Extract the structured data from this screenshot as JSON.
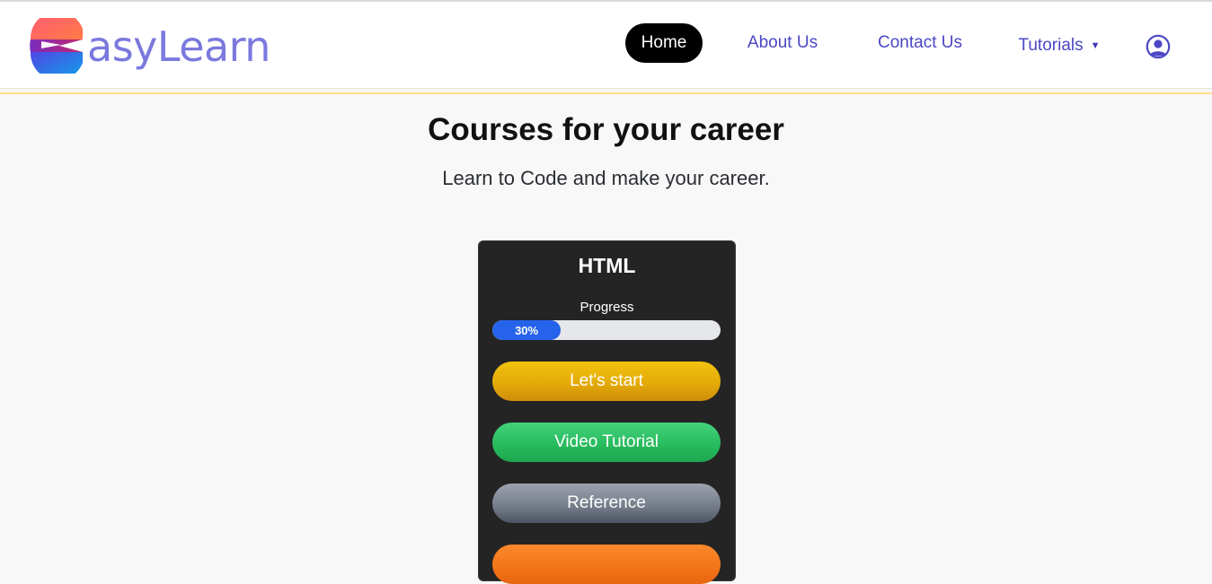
{
  "brand": {
    "text": "asyLearn",
    "text_color": "#7b79dd",
    "logo_icon": "easylearn-logo-e-icon"
  },
  "nav": {
    "items": [
      {
        "label": "Home",
        "active": true
      },
      {
        "label": "About Us",
        "active": false
      },
      {
        "label": "Contact Us",
        "active": false
      },
      {
        "label": "Tutorials",
        "active": false,
        "dropdown": true
      }
    ],
    "dropdown_icon": "caret-down-icon",
    "caret": "▼",
    "account_icon": "user-circle-icon",
    "link_color": "#4b47c4"
  },
  "hero": {
    "title": "Courses for your career",
    "subtitle": "Learn to Code and make your career."
  },
  "course_card": {
    "title": "HTML",
    "progress_label": "Progress",
    "progress_percent": 30,
    "progress_text": "30%",
    "buttons": [
      {
        "label": "Let's start",
        "color": "#e4ab08"
      },
      {
        "label": "Video Tutorial",
        "color": "#27b95c"
      },
      {
        "label": "Reference",
        "color": "#6b7280"
      },
      {
        "label": "",
        "color": "#f47318"
      }
    ]
  },
  "colors": {
    "page_background": "#f8f8f8",
    "card_background": "#242424",
    "header_accent_line": "#ffe08a",
    "active_nav_background": "#000000",
    "progress_fill": "#2563eb",
    "progress_track": "#e5e7eb"
  }
}
